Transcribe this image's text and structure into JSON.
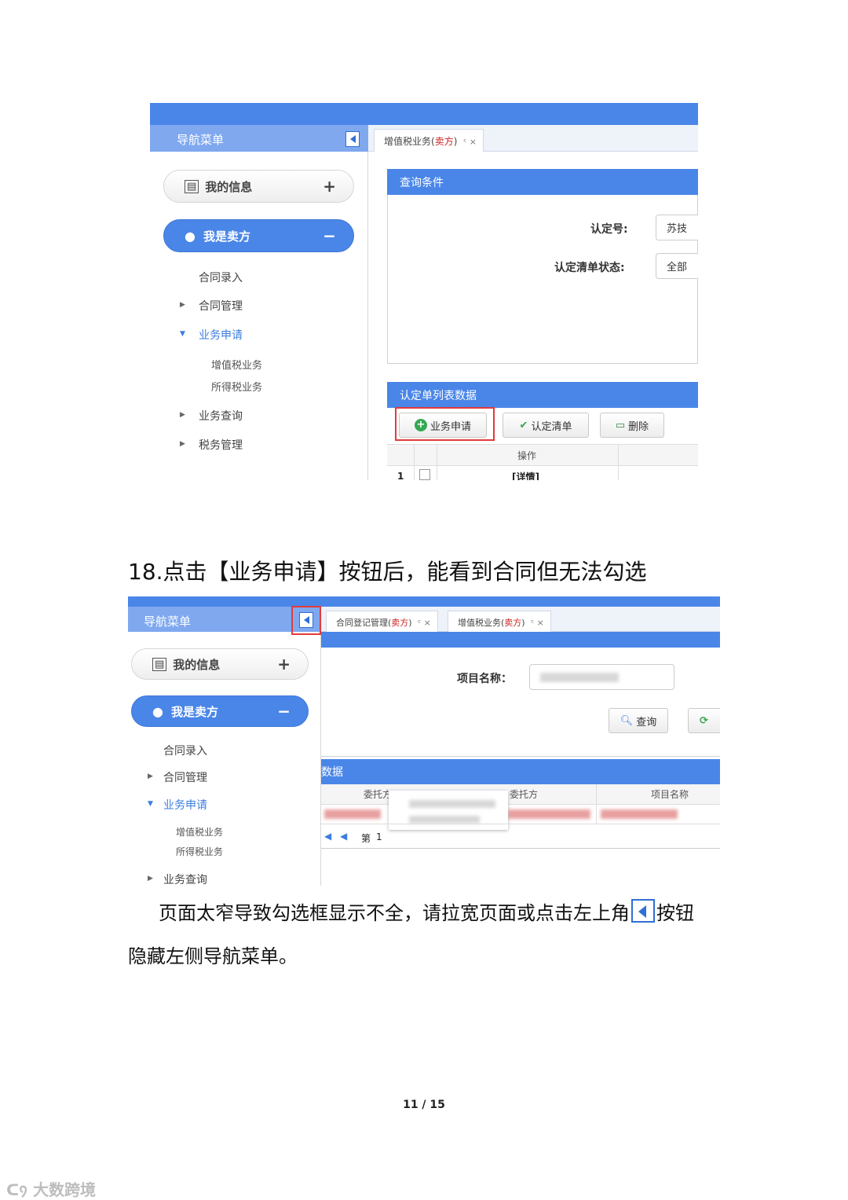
{
  "screenshot1": {
    "nav_title": "导航菜单",
    "my_info": "我的信息",
    "seller": "我是卖方",
    "menu": {
      "contract_entry": "合同录入",
      "contract_manage": "合同管理",
      "business_apply": "业务申请",
      "vat": "增值税业务",
      "income_tax": "所得税业务",
      "business_query": "业务查询",
      "tax_manage": "税务管理"
    },
    "tab": {
      "label": "增值税业务(",
      "red": "卖方",
      "suffix": ")"
    },
    "query_title": "查询条件",
    "cert_no_label": "认定号:",
    "cert_no_value": "苏技",
    "status_label": "认定清单状态:",
    "status_value": "全部",
    "list_title": "认定单列表数据",
    "btn_apply": "业务申请",
    "btn_cert_list": "认定清单",
    "btn_delete": "删除",
    "col_op": "操作",
    "row_no": "1",
    "row_detail": "[详情]"
  },
  "heading": "18.点击【业务申请】按钮后，能看到合同但无法勾选",
  "screenshot2": {
    "nav_title": "导航菜单",
    "tab1": {
      "label": "合同登记管理(",
      "red": "卖方",
      "suffix": ")"
    },
    "tab2": {
      "label": "增值税业务(",
      "red": "卖方",
      "suffix": ")"
    },
    "my_info": "我的信息",
    "seller": "我是卖方",
    "menu": {
      "contract_entry": "合同录入",
      "contract_manage": "合同管理",
      "business_apply": "业务申请",
      "vat": "增值税业务",
      "income_tax": "所得税业务",
      "business_query": "业务查询"
    },
    "project_name_label": "项目名称：",
    "btn_query": "查询",
    "list_title_partial": "数据",
    "col_client": "委托方",
    "col_trustee": "委托方",
    "col_project": "项目名称",
    "pager_page": "第",
    "pager_num": "1"
  },
  "para_line1_a": "页面太窄导致勾选框显示不全，请拉宽页面或点击左上角",
  "para_line1_b": "按钮",
  "para_line2": "隐藏左侧导航菜单。",
  "page_number": "11 / 15",
  "watermark": "大数跨境",
  "colors": {
    "primary_blue": "#4a86e8",
    "nav_header": "#7fa8ef",
    "highlight_red": "#e33a3a",
    "seller_red": "#d02020"
  }
}
